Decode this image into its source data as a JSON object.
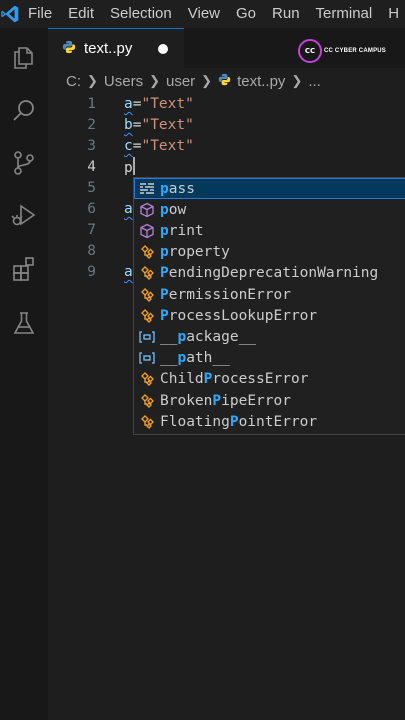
{
  "menubar": {
    "items": [
      "File",
      "Edit",
      "Selection",
      "View",
      "Go",
      "Run",
      "Terminal",
      "H"
    ]
  },
  "activity_bar": {
    "icons": [
      "explorer-icon",
      "search-icon",
      "source-control-icon",
      "run-debug-icon",
      "extensions-icon",
      "testing-icon"
    ]
  },
  "tab": {
    "label": "text..py",
    "modified": true
  },
  "logo": {
    "mark": "CC",
    "text": "CC CYBER CAMPUS"
  },
  "breadcrumb": {
    "parts": [
      "C:",
      "Users",
      "user",
      "text..py",
      "..."
    ]
  },
  "editor": {
    "lines": [
      {
        "num": "1",
        "var": "a",
        "op": "=",
        "str": "\"Text\""
      },
      {
        "num": "2",
        "var": "b",
        "op": "=",
        "str": "\"Text\""
      },
      {
        "num": "3",
        "var": "c",
        "op": "=",
        "str": "\"Text\""
      },
      {
        "num": "4",
        "var": "p",
        "op": "",
        "str": ""
      },
      {
        "num": "5",
        "var": "",
        "op": "",
        "str": ""
      },
      {
        "num": "6",
        "var": "a",
        "op": "",
        "str": ""
      },
      {
        "num": "7",
        "var": "",
        "op": "",
        "str": ""
      },
      {
        "num": "8",
        "var": "",
        "op": "",
        "str": ""
      },
      {
        "num": "9",
        "var": "a",
        "op": "",
        "str": ""
      }
    ],
    "active_line": 4
  },
  "suggestions": [
    {
      "pre": "",
      "hl": "p",
      "post": "ass",
      "kind": "keyword-icon"
    },
    {
      "pre": "",
      "hl": "p",
      "post": "ow",
      "kind": "method-cube-icon"
    },
    {
      "pre": "",
      "hl": "p",
      "post": "rint",
      "kind": "method-cube-icon"
    },
    {
      "pre": "",
      "hl": "p",
      "post": "roperty",
      "kind": "class-icon"
    },
    {
      "pre": "",
      "hl": "P",
      "post": "endingDeprecationWarning",
      "kind": "class-icon"
    },
    {
      "pre": "",
      "hl": "P",
      "post": "ermissionError",
      "kind": "class-icon"
    },
    {
      "pre": "",
      "hl": "P",
      "post": "rocessLookupError",
      "kind": "class-icon"
    },
    {
      "pre": "__",
      "hl": "p",
      "post": "ackage__",
      "kind": "variable-icon"
    },
    {
      "pre": "__",
      "hl": "p",
      "post": "ath__",
      "kind": "variable-icon"
    },
    {
      "pre": "Child",
      "hl": "P",
      "post": "rocessError",
      "kind": "class-icon"
    },
    {
      "pre": "Broken",
      "hl": "P",
      "post": "ipeError",
      "kind": "class-icon"
    },
    {
      "pre": "Floating",
      "hl": "P",
      "post": "ointError",
      "kind": "class-icon"
    }
  ],
  "colors": {
    "accent": "#0078d4",
    "string": "#ce9178",
    "variable": "#9cdcfe",
    "match_highlight": "#2aaaff",
    "selected_row": "#04395e"
  }
}
